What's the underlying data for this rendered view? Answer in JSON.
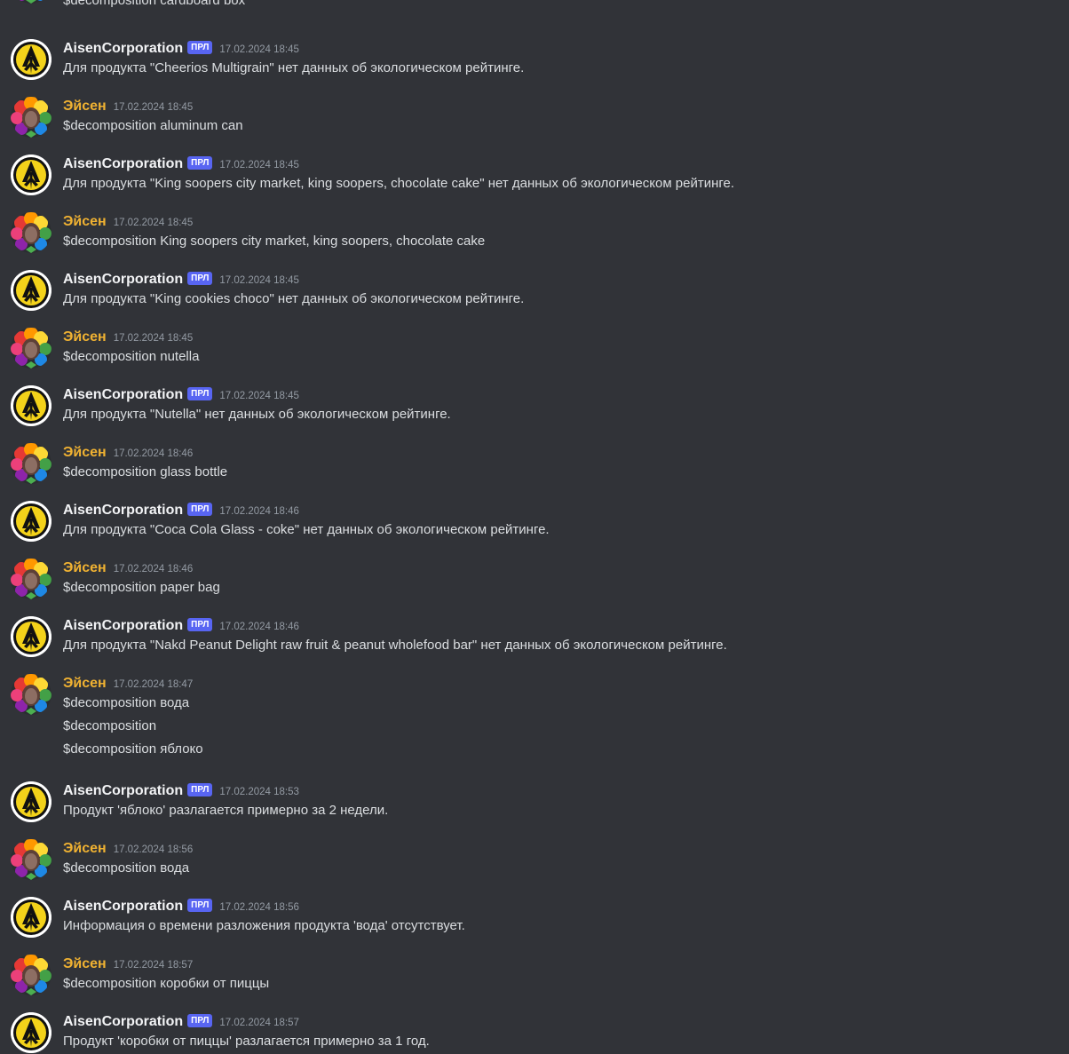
{
  "accent_colors": {
    "background": "#313338",
    "text": "#dbdee1",
    "user_name": "#f0b232",
    "bot_name": "#f2f3f5",
    "badge": "#5865f2",
    "timestamp": "#949ba4"
  },
  "messages": [
    {
      "kind": "continuation",
      "lines": [
        "$decomposition cardboard box"
      ]
    },
    {
      "kind": "bot",
      "author": "AisenCorporation",
      "badge": "ПРЛ",
      "time": "17.02.2024 18:45",
      "lines": [
        "Для продукта \"Cheerios Multigrain\" нет данных об экологическом рейтинге."
      ]
    },
    {
      "kind": "user",
      "author": "Эйсен",
      "time": "17.02.2024 18:45",
      "lines": [
        "$decomposition aluminum can"
      ]
    },
    {
      "kind": "bot",
      "author": "AisenCorporation",
      "badge": "ПРЛ",
      "time": "17.02.2024 18:45",
      "lines": [
        "Для продукта \"King soopers city market, king soopers, chocolate cake\" нет данных об экологическом рейтинге."
      ]
    },
    {
      "kind": "user",
      "author": "Эйсен",
      "time": "17.02.2024 18:45",
      "lines": [
        "$decomposition King soopers city market, king soopers, chocolate cake"
      ]
    },
    {
      "kind": "bot",
      "author": "AisenCorporation",
      "badge": "ПРЛ",
      "time": "17.02.2024 18:45",
      "lines": [
        "Для продукта \"King cookies choco\" нет данных об экологическом рейтинге."
      ]
    },
    {
      "kind": "user",
      "author": "Эйсен",
      "time": "17.02.2024 18:45",
      "lines": [
        "$decomposition nutella"
      ]
    },
    {
      "kind": "bot",
      "author": "AisenCorporation",
      "badge": "ПРЛ",
      "time": "17.02.2024 18:45",
      "lines": [
        "Для продукта \"Nutella\" нет данных об экологическом рейтинге."
      ]
    },
    {
      "kind": "user",
      "author": "Эйсен",
      "time": "17.02.2024 18:46",
      "lines": [
        "$decomposition glass bottle"
      ]
    },
    {
      "kind": "bot",
      "author": "AisenCorporation",
      "badge": "ПРЛ",
      "time": "17.02.2024 18:46",
      "lines": [
        "Для продукта \"Coca Cola Glass - coke\" нет данных об экологическом рейтинге."
      ]
    },
    {
      "kind": "user",
      "author": "Эйсен",
      "time": "17.02.2024 18:46",
      "lines": [
        "$decomposition paper bag"
      ]
    },
    {
      "kind": "bot",
      "author": "AisenCorporation",
      "badge": "ПРЛ",
      "time": "17.02.2024 18:46",
      "lines": [
        "Для продукта \"Nakd Peanut Delight raw fruit & peanut wholefood bar\" нет данных об экологическом рейтинге."
      ]
    },
    {
      "kind": "user",
      "author": "Эйсен",
      "time": "17.02.2024 18:47",
      "lines": [
        "$decomposition вода",
        "$decomposition",
        "$decomposition яблоко"
      ]
    },
    {
      "kind": "bot",
      "author": "AisenCorporation",
      "badge": "ПРЛ",
      "time": "17.02.2024 18:53",
      "lines": [
        "Продукт 'яблоко' разлагается примерно за 2 недели."
      ]
    },
    {
      "kind": "user",
      "author": "Эйсен",
      "time": "17.02.2024 18:56",
      "lines": [
        "$decomposition вода"
      ]
    },
    {
      "kind": "bot",
      "author": "AisenCorporation",
      "badge": "ПРЛ",
      "time": "17.02.2024 18:56",
      "lines": [
        "Информация о времени разложения продукта 'вода' отсутствует."
      ]
    },
    {
      "kind": "user",
      "author": "Эйсен",
      "time": "17.02.2024 18:57",
      "lines": [
        "$decomposition коробки от пиццы"
      ]
    },
    {
      "kind": "bot",
      "author": "AisenCorporation",
      "badge": "ПРЛ",
      "time": "17.02.2024 18:57",
      "lines": [
        "Продукт 'коробки от пиццы' разлагается примерно за 1 год."
      ]
    }
  ]
}
